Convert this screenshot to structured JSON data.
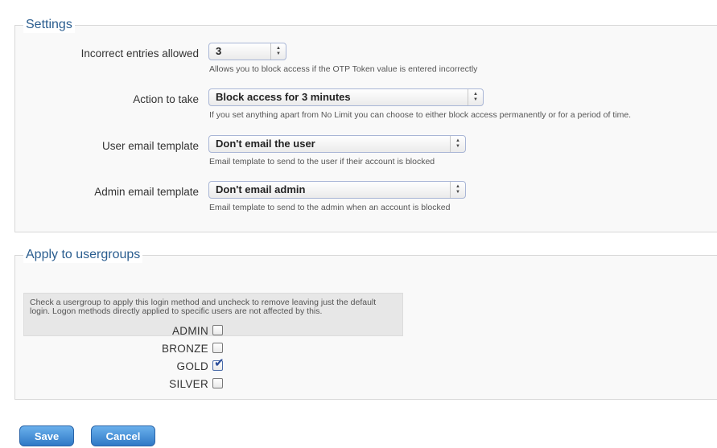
{
  "settings": {
    "legend": "Settings",
    "incorrect_entries": {
      "label": "Incorrect entries allowed",
      "value": "3",
      "help": "Allows you to block access if the OTP Token value is entered incorrectly"
    },
    "action": {
      "label": "Action to take",
      "value": "Block access for 3 minutes",
      "help": "If you set anything apart from No Limit you can choose to either block access permanently or for a period of time."
    },
    "user_email": {
      "label": "User email template",
      "value": "Don't email the user",
      "help": "Email template to send to the user if their account is blocked"
    },
    "admin_email": {
      "label": "Admin email template",
      "value": "Don't email admin",
      "help": "Email template to send to the admin when an account is blocked"
    }
  },
  "usergroups": {
    "legend": "Apply to usergroups",
    "note": "Check a usergroup to apply this login method and uncheck to remove leaving just the default login. Logon methods directly applied to specific users are not affected by this.",
    "groups": [
      {
        "name": "ADMIN",
        "checked": false
      },
      {
        "name": "BRONZE",
        "checked": false
      },
      {
        "name": "GOLD",
        "checked": true
      },
      {
        "name": "SILVER",
        "checked": false
      }
    ]
  },
  "buttons": {
    "save": "Save",
    "cancel": "Cancel"
  },
  "colors": {
    "legend": "#2a5d8f",
    "button": "#3a86d2",
    "select_border": "#a9b6d6"
  }
}
